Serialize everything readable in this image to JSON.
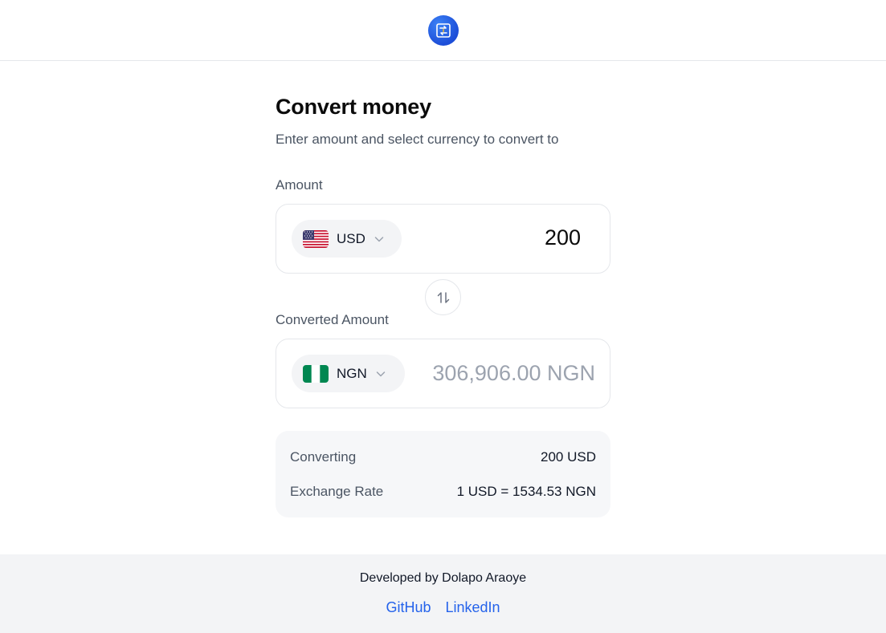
{
  "header": {
    "logo_icon": "currency-exchange-icon"
  },
  "main": {
    "title": "Convert money",
    "subtitle": "Enter amount and select currency to convert to",
    "amount_label": "Amount",
    "from": {
      "currency": "USD",
      "flag": "us-flag-icon",
      "value": "200"
    },
    "converted_label": "Converted Amount",
    "to": {
      "currency": "NGN",
      "flag": "ng-flag-icon",
      "value": "306,906.00 NGN"
    },
    "swap_icon": "swap-arrows-icon"
  },
  "summary": {
    "converting_label": "Converting",
    "converting_value": "200 USD",
    "rate_label": "Exchange Rate",
    "rate_value": "1 USD = 1534.53 NGN"
  },
  "footer": {
    "credit": "Developed by Dolapo Araoye",
    "links": [
      "GitHub",
      "LinkedIn"
    ]
  },
  "colors": {
    "accent": "#2563eb",
    "logo": "#1d4ed8",
    "muted": "#9ca3af"
  }
}
